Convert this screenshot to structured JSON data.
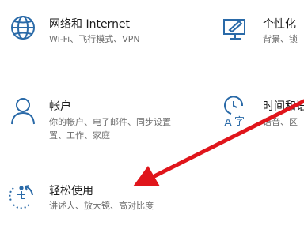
{
  "tiles": {
    "network": {
      "title": "网络和 Internet",
      "desc": [
        "Wi-Fi、飞行模式、VPN"
      ],
      "icon": "globe-icon"
    },
    "personalization": {
      "title": "个性化",
      "desc": [
        "背景、锁"
      ],
      "icon": "personalization-icon"
    },
    "accounts": {
      "title": "帐户",
      "desc": [
        "你的帐户、电子邮件、同步设置",
        "置、工作、家庭"
      ],
      "icon": "person-icon"
    },
    "time_language": {
      "title": "时间和语",
      "desc": [
        "语音、区"
      ],
      "icon": "time-language-icon"
    },
    "ease_of_access": {
      "title": "轻松使用",
      "desc": [
        "讲述人、放大镜、高对比度"
      ],
      "icon": "ease-of-access-icon"
    }
  },
  "colors": {
    "accent": "#2a6aa8",
    "title_text": "#1a1a1a",
    "desc_text": "#6e6e6e",
    "annotation_arrow": "#e0151b"
  }
}
